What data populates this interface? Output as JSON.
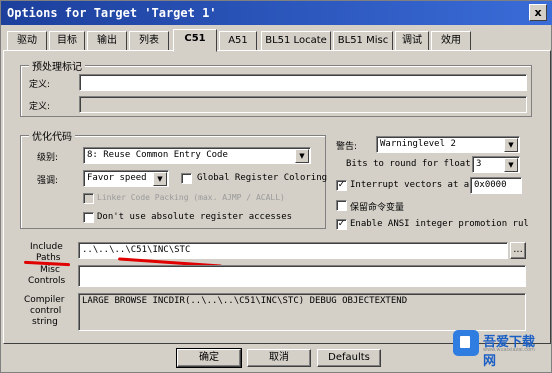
{
  "window": {
    "title": "Options for Target 'Target 1'",
    "close_glyph": "x"
  },
  "tabs": [
    {
      "label": "驱动"
    },
    {
      "label": "目标"
    },
    {
      "label": "输出"
    },
    {
      "label": "列表"
    },
    {
      "label": "C51"
    },
    {
      "label": "A51"
    },
    {
      "label": "BL51 Locate"
    },
    {
      "label": "BL51 Misc"
    },
    {
      "label": "调试"
    },
    {
      "label": "效用"
    }
  ],
  "active_tab": "C51",
  "preprocessor": {
    "title": "预处理标记",
    "define_label": "定义:",
    "define_value": "",
    "undefine_label": "定义:",
    "undefine_value": ""
  },
  "optimization": {
    "title": "优化代码",
    "level_label": "级别:",
    "level_value": "8: Reuse Common Entry Code",
    "emphasis_label": "强调:",
    "emphasis_value": "Favor speed",
    "global_reg_coloring": {
      "label": "Global Register Coloring",
      "checked": false
    },
    "linker_code_packing": {
      "label": "Linker Code Packing (max. AJMP / ACALL)",
      "checked": false,
      "disabled": true
    },
    "no_absolute_reg": {
      "label": "Don't use absolute register accesses",
      "checked": false
    }
  },
  "right": {
    "warnings_label": "警告:",
    "warnings_value": "Warninglevel 2",
    "bits_label": "Bits to round for float",
    "bits_value": "3",
    "interrupt_vectors": {
      "label": "Interrupt vectors at a",
      "checked": true,
      "value": "0x0000"
    },
    "keep_vars": {
      "label": "保留命令变量",
      "checked": false
    },
    "ansi_promotion": {
      "label": "Enable ANSI integer promotion rul",
      "checked": true
    }
  },
  "include_paths": {
    "label_line1": "Include",
    "label_line2": "Paths",
    "value": "..\\..\\..\\C51\\INC\\STC",
    "browse": "..."
  },
  "misc_controls": {
    "label_line1": "Misc",
    "label_line2": "Controls",
    "value": ""
  },
  "compiler_control": {
    "label_line1": "Compiler",
    "label_line2": "control",
    "label_line3": "string",
    "value": "LARGE BROWSE INCDIR(..\\..\\..\\C51\\INC\\STC) DEBUG OBJECTEXTEND"
  },
  "buttons": {
    "ok": "确定",
    "cancel": "取消",
    "defaults": "Defaults"
  },
  "watermark": {
    "name": "吾爱下载网",
    "url": "www.wuaixiazai.com"
  },
  "colors": {
    "annotation_red": "#e00000",
    "titlebar": "#1c3f9c",
    "dialog_bg": "#d4d0c8"
  }
}
